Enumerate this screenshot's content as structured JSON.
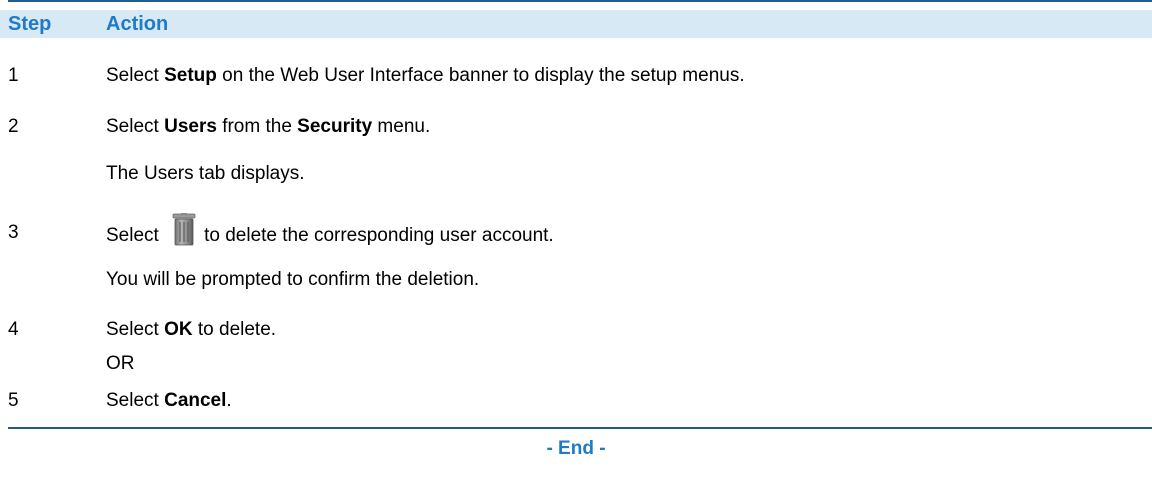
{
  "table": {
    "header_step": "Step",
    "header_action": "Action",
    "rows": [
      {
        "step": "1",
        "lines": [
          [
            "Select ",
            "Setup",
            " on the Web User Interface banner to display the setup menus."
          ]
        ]
      },
      {
        "step": "2",
        "lines": [
          [
            "Select ",
            "Users",
            " from the ",
            "Security",
            " menu."
          ],
          [
            "The Users tab displays."
          ]
        ]
      },
      {
        "step": "3",
        "lines": [
          [
            "Select ",
            "to delete the corresponding user account."
          ],
          [
            "You will be prompted to confirm the deletion."
          ]
        ]
      },
      {
        "step": "4",
        "lines": [
          [
            "Select ",
            "OK",
            " to delete."
          ],
          [
            "OR"
          ]
        ]
      },
      {
        "step": "5",
        "lines": [
          [
            "Select ",
            "Cancel",
            "."
          ]
        ]
      }
    ]
  },
  "end_text": "- End -",
  "icons": {
    "delete": "trash-icon"
  },
  "colors": {
    "accent": "#1f7ac8",
    "rule": "#1f5f8b",
    "header_bg": "#d8e9f6"
  }
}
